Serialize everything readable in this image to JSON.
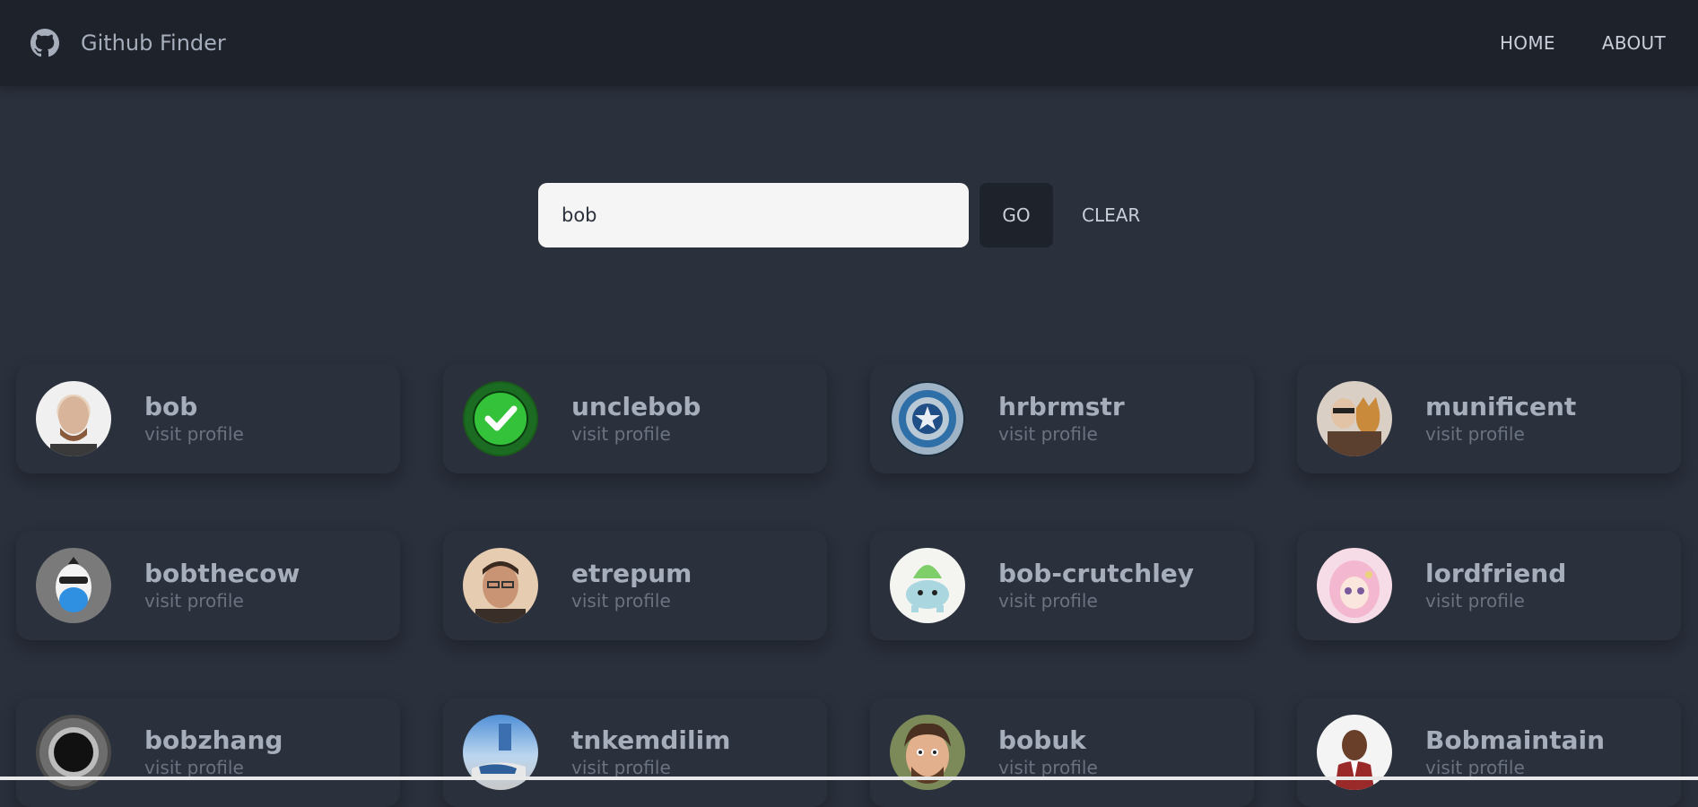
{
  "navbar": {
    "title": "Github Finder",
    "links": [
      "HOME",
      "ABOUT"
    ]
  },
  "search": {
    "value": "bob",
    "go_label": "GO",
    "clear_label": "CLEAR"
  },
  "users": [
    {
      "login": "bob",
      "link": "visit profile",
      "avatar": "bald-man-photo"
    },
    {
      "login": "unclebob",
      "link": "visit profile",
      "avatar": "clean-code-badge"
    },
    {
      "login": "hrbrmstr",
      "link": "visit profile",
      "avatar": "captain-america-shield"
    },
    {
      "login": "munificent",
      "link": "visit profile",
      "avatar": "man-with-dog-photo"
    },
    {
      "login": "bobthecow",
      "link": "visit profile",
      "avatar": "cow-mask-cartoon"
    },
    {
      "login": "etrepum",
      "link": "visit profile",
      "avatar": "man-with-glasses-photo"
    },
    {
      "login": "bob-crutchley",
      "link": "visit profile",
      "avatar": "bulbasaur-drawing"
    },
    {
      "login": "lordfriend",
      "link": "visit profile",
      "avatar": "anime-girl"
    },
    {
      "login": "bobzhang",
      "link": "visit profile",
      "avatar": "dark-ring-photo"
    },
    {
      "login": "tnkemdilim",
      "link": "visit profile",
      "avatar": "sneaker-photo"
    },
    {
      "login": "bobuk",
      "link": "visit profile",
      "avatar": "bearded-face-photo"
    },
    {
      "login": "Bobmaintain",
      "link": "visit profile",
      "avatar": "man-in-suit-photo"
    }
  ],
  "colors": {
    "background": "#2a303c",
    "navbar": "#1d222b",
    "text": "#a6adbb",
    "muted": "#6b7280",
    "input": "#f5f5f5"
  }
}
